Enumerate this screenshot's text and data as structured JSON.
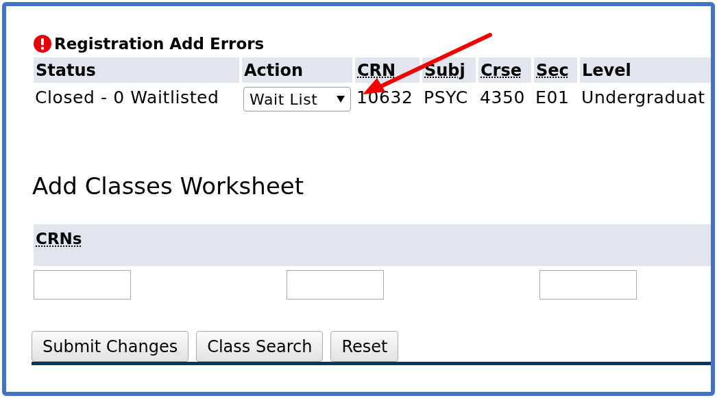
{
  "errors": {
    "title": "Registration Add Errors",
    "columns": [
      {
        "label": "Status",
        "abbreviation": false
      },
      {
        "label": "Action",
        "abbreviation": false
      },
      {
        "label": "CRN",
        "abbreviation": true
      },
      {
        "label": "Subj",
        "abbreviation": true
      },
      {
        "label": "Crse",
        "abbreviation": true
      },
      {
        "label": "Sec",
        "abbreviation": true
      },
      {
        "label": "Level",
        "abbreviation": false
      }
    ],
    "rows": [
      {
        "status": "Closed - 0 Waitlisted",
        "action": "Wait List",
        "crn": "10632",
        "subj": "PSYC",
        "crse": "4350",
        "sec": "E01",
        "level": "Undergraduat"
      }
    ]
  },
  "worksheet": {
    "title": "Add Classes Worksheet",
    "crns_label": "CRNs",
    "buttons": [
      "Submit Changes",
      "Class Search",
      "Reset"
    ]
  }
}
